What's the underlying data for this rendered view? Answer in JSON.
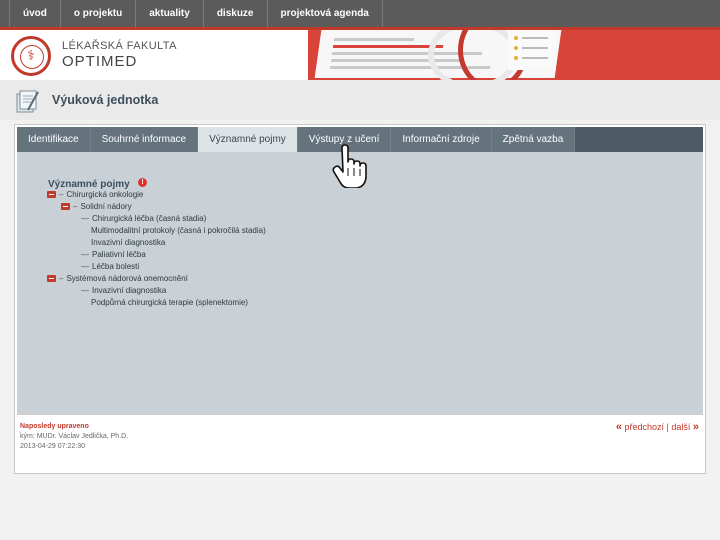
{
  "nav": {
    "items": [
      "úvod",
      "o projektu",
      "aktuality",
      "diskuze",
      "projektová agenda"
    ]
  },
  "header": {
    "faculty_line1": "LÉKAŘSKÁ FAKULTA",
    "faculty_line2": "OPTIMED",
    "seal_icon": "caduceus-seal-icon"
  },
  "page": {
    "title": "Výuková jednotka"
  },
  "tabs": [
    {
      "label": "Identifikace",
      "active": false
    },
    {
      "label": "Souhrné informace",
      "active": false
    },
    {
      "label": "Významné pojmy",
      "active": true
    },
    {
      "label": "Výstupy z učení",
      "active": false
    },
    {
      "label": "Informační zdroje",
      "active": false
    },
    {
      "label": "Zpětná vazba",
      "active": false
    }
  ],
  "content": {
    "section_title": "Významné pojmy",
    "alert_glyph": "!",
    "tree": [
      {
        "text": "Chirurgická onkologie",
        "level": 0,
        "kind": "toggle"
      },
      {
        "text": "Solidní nádory",
        "level": 1,
        "kind": "toggle"
      },
      {
        "text": "Chirurgická léčba (časná stadia)",
        "level": 2,
        "kind": "dash"
      },
      {
        "text": "Multimodalitní protokoly (časná i pokročilá stadia)",
        "level": 2,
        "kind": "leaf"
      },
      {
        "text": "Invazivní diagnostika",
        "level": 2,
        "kind": "leaf"
      },
      {
        "text": "Paliativní léčba",
        "level": 2,
        "kind": "dash"
      },
      {
        "text": "Léčba bolesti",
        "level": 2,
        "kind": "dash"
      },
      {
        "text": "Systémová nádorová onemocnění",
        "level": 1,
        "kind": "toggle"
      },
      {
        "text": "Invazivní diagnostika",
        "level": 2,
        "kind": "dash"
      },
      {
        "text": "Podpůrná chirurgická terapie (splenektomie)",
        "level": 2,
        "kind": "leaf"
      }
    ]
  },
  "footer": {
    "label": "Naposledy upraveno",
    "author": "kým: MUDr. Václav Jedlička, Ph.D.",
    "date": "2013-04-29 07:22:30",
    "prev": "předchozí",
    "next": "další",
    "prev_glyph": "«",
    "next_glyph": "»"
  },
  "colors": {
    "accent": "#c0392b",
    "nav_bg": "#5b5b5b",
    "tab_bg": "#65737d",
    "content_bg": "#c9d0d6"
  }
}
